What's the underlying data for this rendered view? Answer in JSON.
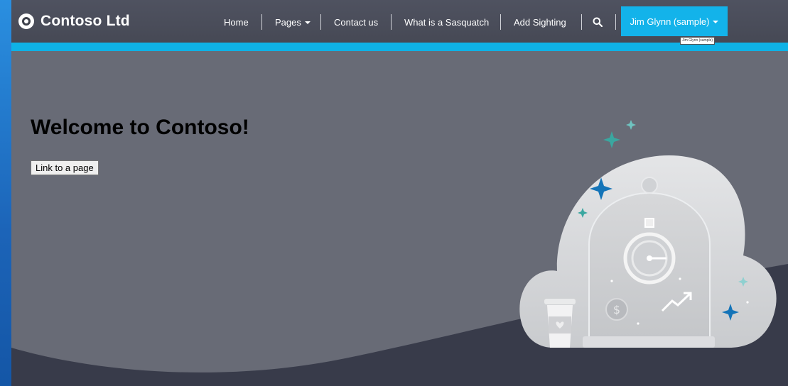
{
  "brand": {
    "name": "Contoso Ltd",
    "logo_icon": "contoso-logo-icon"
  },
  "nav": {
    "items": [
      {
        "label": "Home",
        "has_dropdown": false
      },
      {
        "label": "Pages",
        "has_dropdown": true
      },
      {
        "label": "Contact us",
        "has_dropdown": false
      },
      {
        "label": "What is a Sasquatch",
        "has_dropdown": false
      },
      {
        "label": "Add Sighting",
        "has_dropdown": false
      }
    ],
    "search_icon": "search-icon"
  },
  "user": {
    "label": "Jim Glynn (sample)",
    "tooltip": "Jim Glynn (sample)"
  },
  "hero": {
    "title": "Welcome to Contoso!",
    "button_label": "Link to a page"
  },
  "colors": {
    "header": "#4a4d59",
    "accent": "#0fb2e6",
    "user_button": "#13b3ea",
    "hero_bg": "#686b76",
    "footer_wave": "#383b4a"
  }
}
